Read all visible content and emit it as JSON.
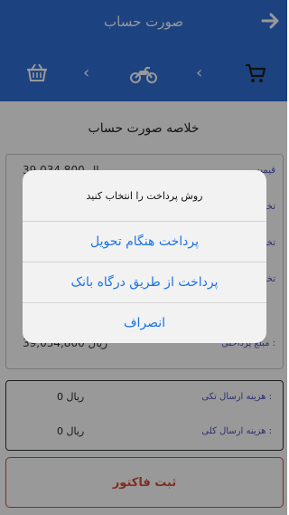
{
  "header": {
    "title": "صورت حساب",
    "steps": [
      {
        "icon": "cart-icon"
      },
      {
        "icon": "chevron-left-icon"
      },
      {
        "icon": "motorcycle-icon"
      },
      {
        "icon": "chevron-left-icon"
      },
      {
        "icon": "basket-icon"
      }
    ]
  },
  "summary": {
    "title": "خلاصه صورت حساب",
    "rows": [
      {
        "label": "قیمت",
        "value": "39,034,800 ریال"
      },
      {
        "label": "تخفیف",
        "value": ""
      },
      {
        "label": "تخفیف",
        "value": ""
      },
      {
        "label": "تخفیف",
        "value": ""
      }
    ],
    "payable": {
      "label": "مبلغ پرداختی :",
      "value": "39,034,800 ریال"
    }
  },
  "shipping": {
    "single": {
      "label": "هزینه ارسال تکی :",
      "value": "0 ریال"
    },
    "total": {
      "label": "هزینه ارسال کلی :",
      "value": "0 ریال"
    }
  },
  "submit_label": "ثبت فاکتور",
  "dialog": {
    "message": "روش پرداخت را انتخاب کنید",
    "options": [
      "پرداخت هنگام تحویل",
      "پرداخت از طریق درگاه بانک",
      "انصراف"
    ]
  },
  "colors": {
    "header_bg": "#2f6fd6",
    "accent_blue": "#1a73e8",
    "label_purple": "#4a52b6",
    "submit_red": "#d84a3a"
  }
}
